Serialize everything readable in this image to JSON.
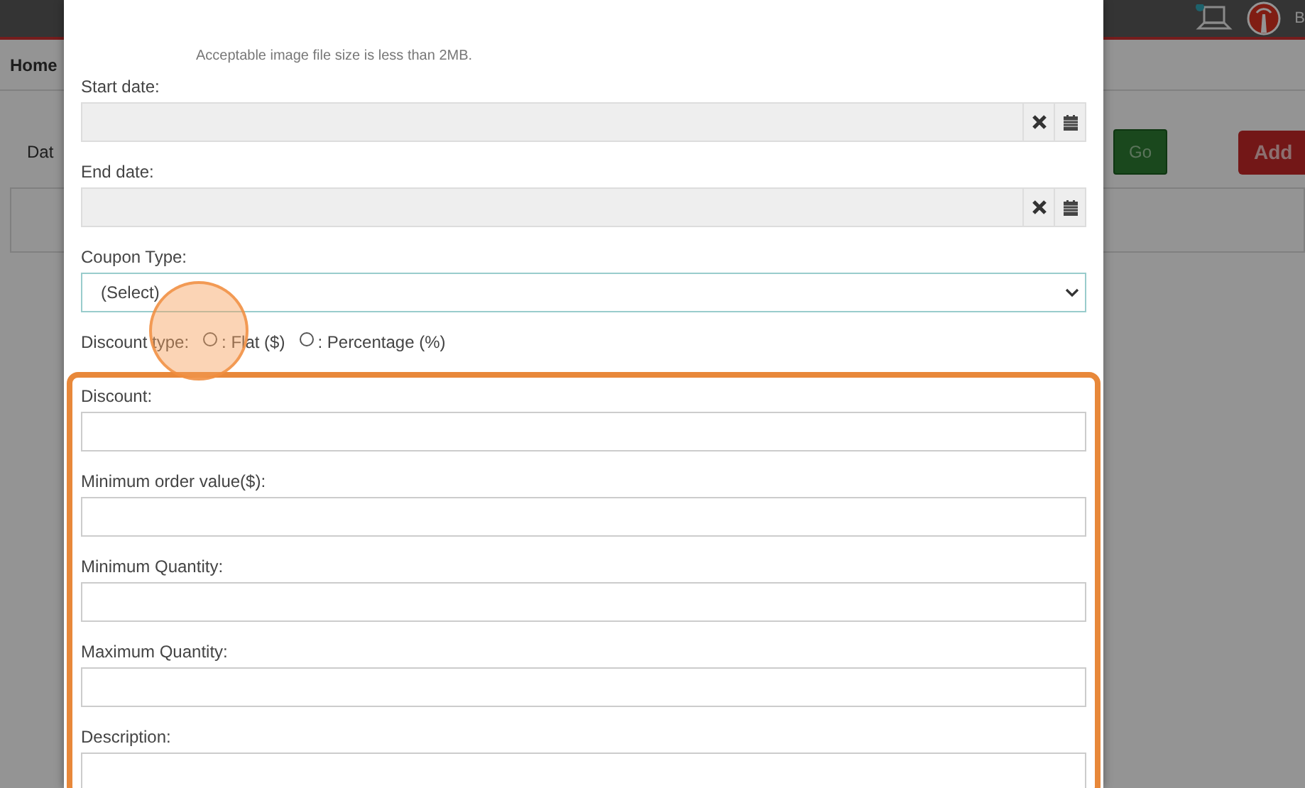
{
  "header": {
    "user_initial": "B"
  },
  "nav": {
    "home": "Home"
  },
  "filter": {
    "label": "Dat"
  },
  "buttons": [
    {
      "label": "Go",
      "kind": "success"
    },
    {
      "label": "Add",
      "kind": "danger"
    }
  ],
  "modal": {
    "hint": "Acceptable image file size is less than 2MB.",
    "fields": [
      {
        "label": "Start date:",
        "kind": "date",
        "highlighted": false
      },
      {
        "label": "End date:",
        "kind": "date",
        "highlighted": false
      },
      {
        "label": "Coupon Type:",
        "kind": "select",
        "value": "(Select)",
        "highlighted": false
      },
      {
        "label": "Discount type:",
        "kind": "radio",
        "highlighted": false,
        "options": [
          {
            "label": ": Flat ($)",
            "checked": false,
            "clicked": true
          },
          {
            "label": ": Percentage (%)",
            "checked": false,
            "clicked": false
          }
        ]
      },
      {
        "label": "Discount:",
        "kind": "text",
        "highlighted": true
      },
      {
        "label": "Minimum order value($):",
        "kind": "text",
        "highlighted": true
      },
      {
        "label": "Minimum Quantity:",
        "kind": "text",
        "highlighted": true
      },
      {
        "label": "Maximum Quantity:",
        "kind": "text",
        "highlighted": true
      },
      {
        "label": "Description:",
        "kind": "text",
        "highlighted": true
      }
    ]
  }
}
